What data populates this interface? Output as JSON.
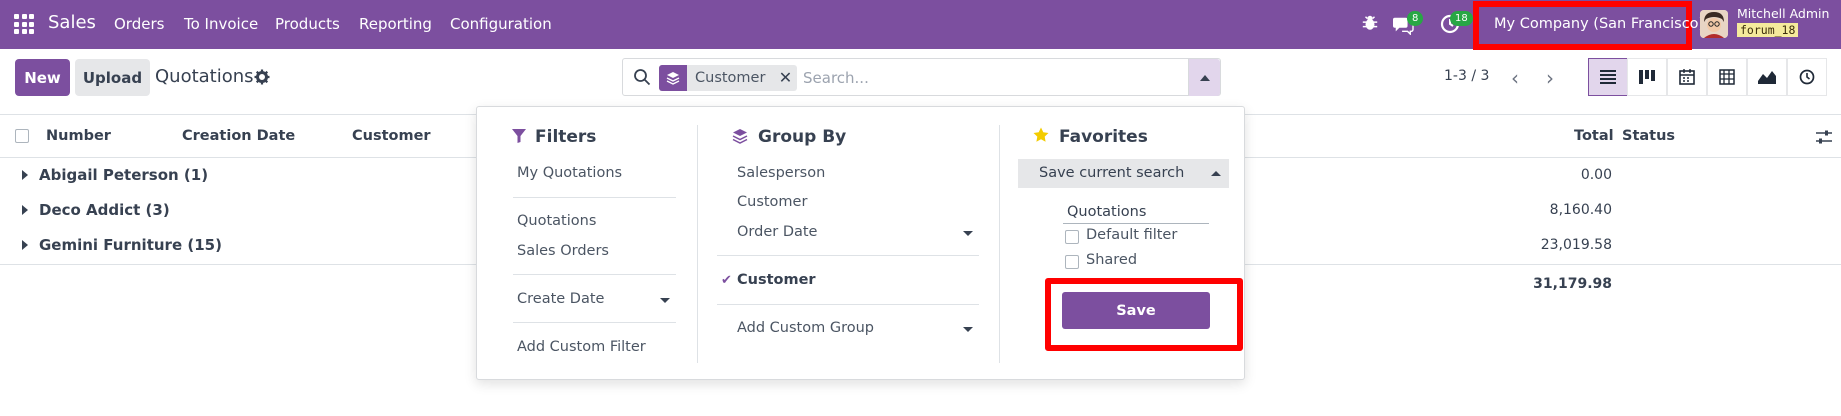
{
  "navbar": {
    "app_name": "Sales",
    "menu": [
      "Orders",
      "To Invoice",
      "Products",
      "Reporting",
      "Configuration"
    ],
    "chat_badge": "8",
    "activity_badge": "18",
    "company": "My Company (San Francisco)",
    "user_name": "Mitchell Admin",
    "db_name": "forum_18"
  },
  "control_panel": {
    "new_label": "New",
    "upload_label": "Upload",
    "title": "Quotations",
    "search": {
      "facet_label": "Customer",
      "placeholder": "Search..."
    },
    "pager": "1-3 / 3"
  },
  "list": {
    "columns": {
      "number": "Number",
      "creation_date": "Creation Date",
      "customer": "Customer",
      "total": "Total",
      "status": "Status"
    },
    "groups": [
      {
        "label": "Abigail Peterson (1)",
        "total": "0.00"
      },
      {
        "label": "Deco Addict (3)",
        "total": "8,160.40"
      },
      {
        "label": "Gemini Furniture (15)",
        "total": "23,019.58"
      }
    ],
    "grand_total": "31,179.98"
  },
  "dropdown": {
    "filters": {
      "title": "Filters",
      "items": [
        "My Quotations",
        "Quotations",
        "Sales Orders",
        "Create Date",
        "Add Custom Filter"
      ]
    },
    "group_by": {
      "title": "Group By",
      "items": [
        "Salesperson",
        "Customer",
        "Order Date",
        "Customer",
        "Add Custom Group"
      ]
    },
    "favorites": {
      "title": "Favorites",
      "save_current": "Save current search",
      "name_value": "Quotations",
      "default_filter": "Default filter",
      "shared": "Shared",
      "save_label": "Save"
    }
  },
  "colors": {
    "brand": "#7c4f9f",
    "highlight": "#ff0000",
    "badge": "#28a745"
  }
}
